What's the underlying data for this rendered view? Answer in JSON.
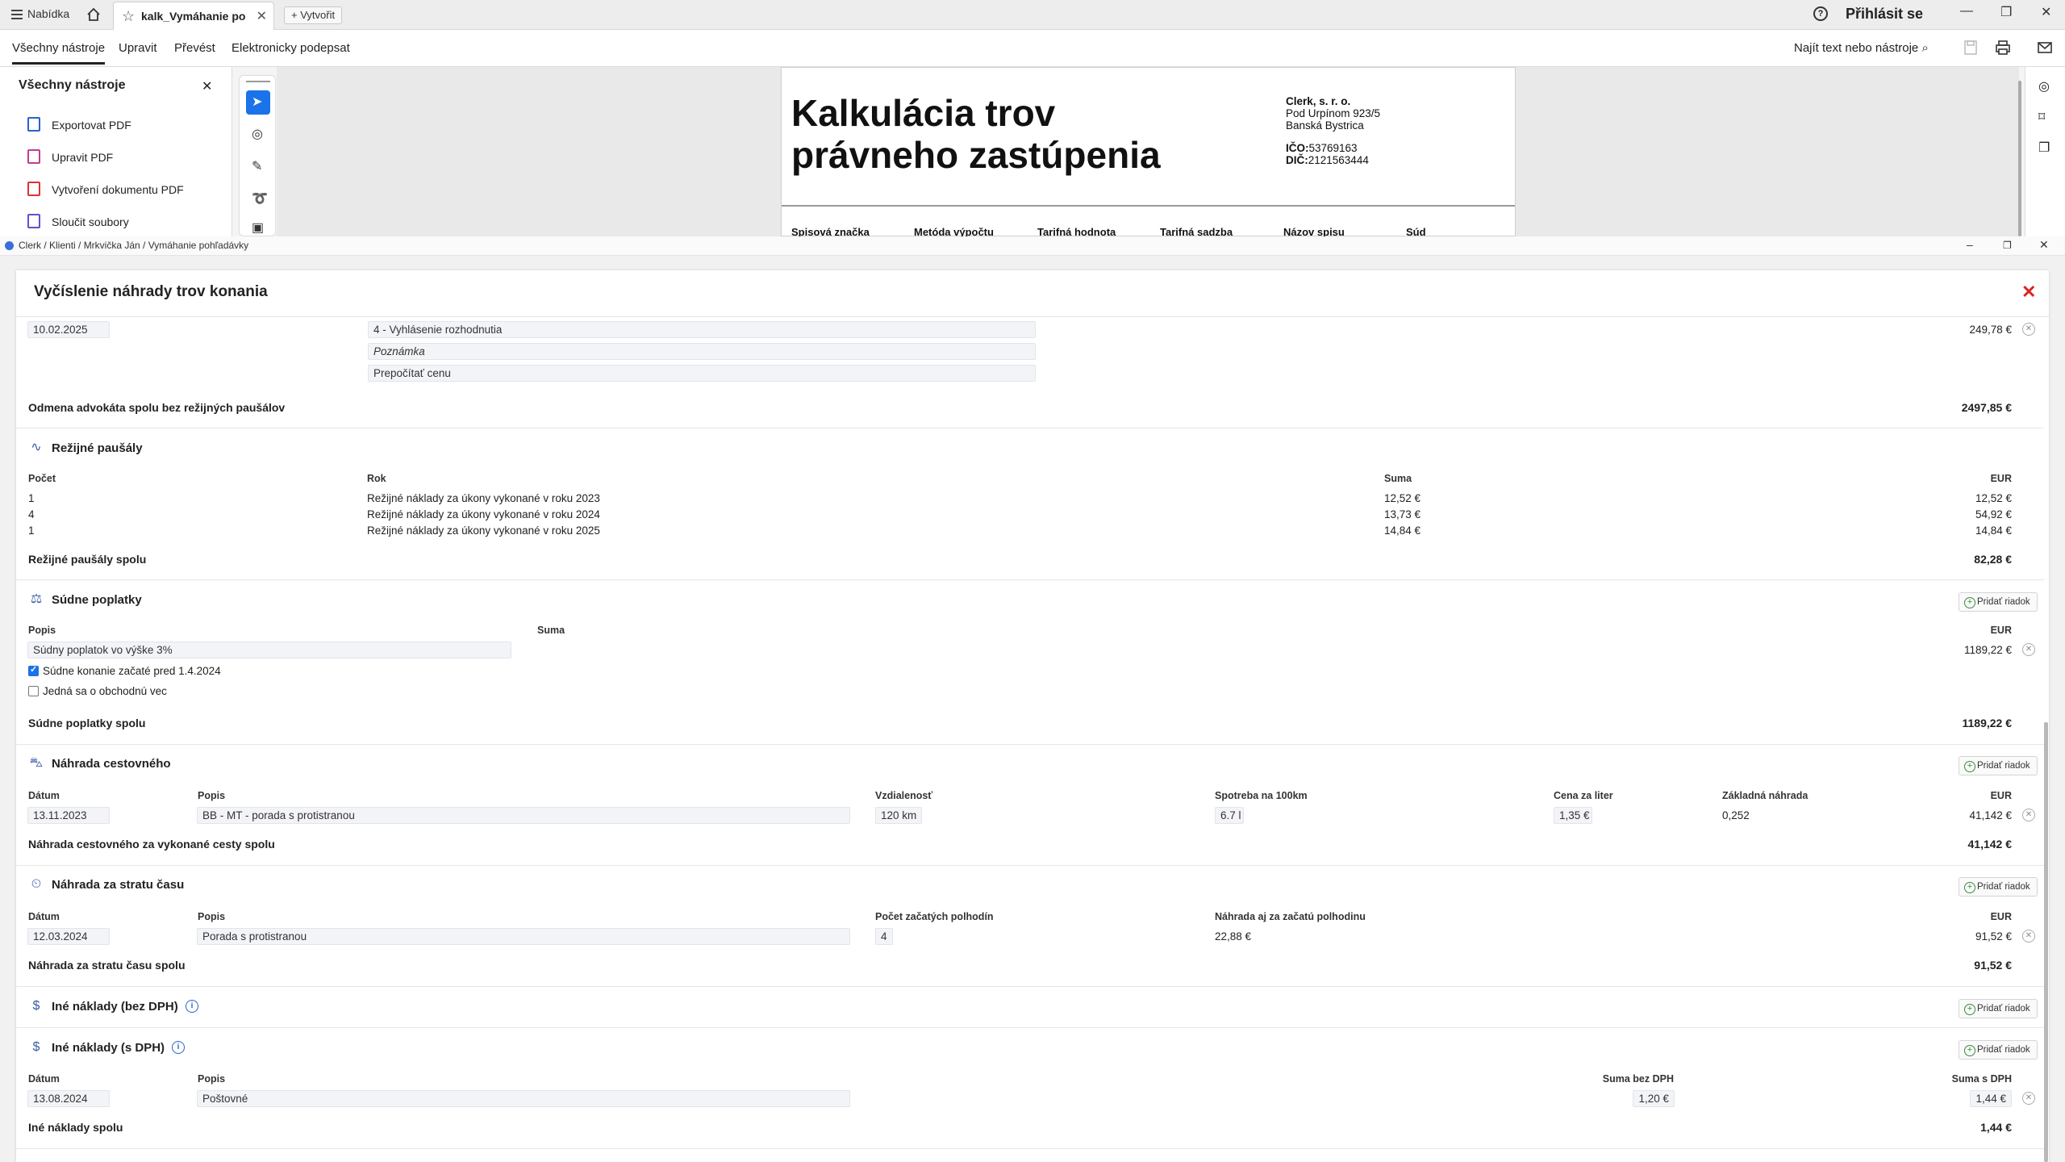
{
  "tabbar": {
    "menu_label": "Nabídka",
    "tab_label": "kalk_Vymáhanie poh...",
    "new_label": "Vytvořit",
    "login_label": "Přihlásit se"
  },
  "toolbar": {
    "items": [
      "Všechny nástroje",
      "Upravit",
      "Převést",
      "Elektronicky podepsat"
    ],
    "search_label": "Najít text nebo nástroje"
  },
  "tools_panel": {
    "title": "Všechny nástroje",
    "items": [
      {
        "label": "Exportovat PDF",
        "color": "#2a62c9"
      },
      {
        "label": "Upravit PDF",
        "color": "#c43c8c"
      },
      {
        "label": "Vytvoření dokumentu PDF",
        "color": "#d33"
      },
      {
        "label": "Sloučit soubory",
        "color": "#6a4ccf"
      }
    ]
  },
  "pdf": {
    "title_line1": "Kalkulácia trov",
    "title_line2": "právneho zastúpenia",
    "company_name": "Clerk, s. r. o.",
    "company_street": "Pod Urpínom 923/5",
    "company_city": "Banská Bystrica",
    "ico_label": "IČO:",
    "ico_value": "53769163",
    "dic_label": "DIČ:",
    "dic_value": "2121563444",
    "columns": [
      "Spisová značka",
      "Metóda výpočtu",
      "Tarifná hodnota",
      "Tarifná sadzba",
      "Názov spisu",
      "Súd"
    ]
  },
  "window": {
    "breadcrumb": "Clerk / Klienti / Mrkvička Ján / Vymáhanie pohľadávky"
  },
  "modal": {
    "title": "Vyčíslenie náhrady trov konania",
    "add_row_label": "Pridať riadok",
    "top_row": {
      "date": "10.02.2025",
      "act": "4 - Vyhlásenie rozhodnutia",
      "note_placeholder": "Poznámka",
      "recalc": "Prepočítať cenu",
      "amount": "249,78 €"
    },
    "attorney_total": {
      "label": "Odmena advokáta spolu bez režijných paušálov",
      "value": "2497,85 €"
    },
    "overhead": {
      "title": "Režijné paušály",
      "headers": [
        "Počet",
        "Rok",
        "Suma",
        "EUR"
      ],
      "rows": [
        {
          "count": "1",
          "desc": "Režijné náklady za úkony vykonané v roku 2023",
          "sum": "12,52 €",
          "eur": "12,52 €"
        },
        {
          "count": "4",
          "desc": "Režijné náklady za úkony vykonané v roku 2024",
          "sum": "13,73 €",
          "eur": "54,92 €"
        },
        {
          "count": "1",
          "desc": "Režijné náklady za úkony vykonané v roku 2025",
          "sum": "14,84 €",
          "eur": "14,84 €"
        }
      ],
      "total_label": "Režijné paušály spolu",
      "total_value": "82,28 €"
    },
    "court": {
      "title": "Súdne poplatky",
      "headers": [
        "Popis",
        "Suma",
        "EUR"
      ],
      "desc": "Súdny poplatok vo výške 3%",
      "eur": "1189,22 €",
      "check1": "Súdne konanie začaté pred 1.4.2024",
      "check2": "Jedná sa o obchodnú vec",
      "total_label": "Súdne poplatky spolu",
      "total_value": "1189,22 €"
    },
    "travel": {
      "title": "Náhrada cestovného",
      "headers": [
        "Dátum",
        "Popis",
        "Vzdialenosť",
        "Spotreba na 100km",
        "Cena za liter",
        "Základná náhrada",
        "EUR"
      ],
      "date": "13.11.2023",
      "desc": "BB - MT - porada s protistranou",
      "distance": "120 km",
      "consumption": "6.7 l",
      "price": "1,35 €",
      "base": "0,252",
      "eur": "41,142 €",
      "total_label": "Náhrada cestovného za vykonané cesty spolu",
      "total_value": "41,142 €"
    },
    "time_loss": {
      "title": "Náhrada za stratu času",
      "headers": [
        "Dátum",
        "Popis",
        "Počet začatých polhodín",
        "Náhrada aj za začatú polhodinu",
        "EUR"
      ],
      "date": "12.03.2024",
      "desc": "Porada s protistranou",
      "count": "4",
      "rate": "22,88 €",
      "eur": "91,52 €",
      "total_label": "Náhrada za stratu času spolu",
      "total_value": "91,52 €"
    },
    "other_no_vat": {
      "title": "Iné náklady (bez DPH)"
    },
    "other_vat": {
      "title": "Iné náklady (s DPH)",
      "headers": [
        "Dátum",
        "Popis",
        "Suma bez DPH",
        "Suma s DPH"
      ],
      "date": "13.08.2024",
      "desc": "Poštovné",
      "sum_no_vat": "1,20 €",
      "sum_vat": "1,44 €",
      "total_label": "Iné náklady spolu",
      "total_value": "1,44 €"
    }
  }
}
